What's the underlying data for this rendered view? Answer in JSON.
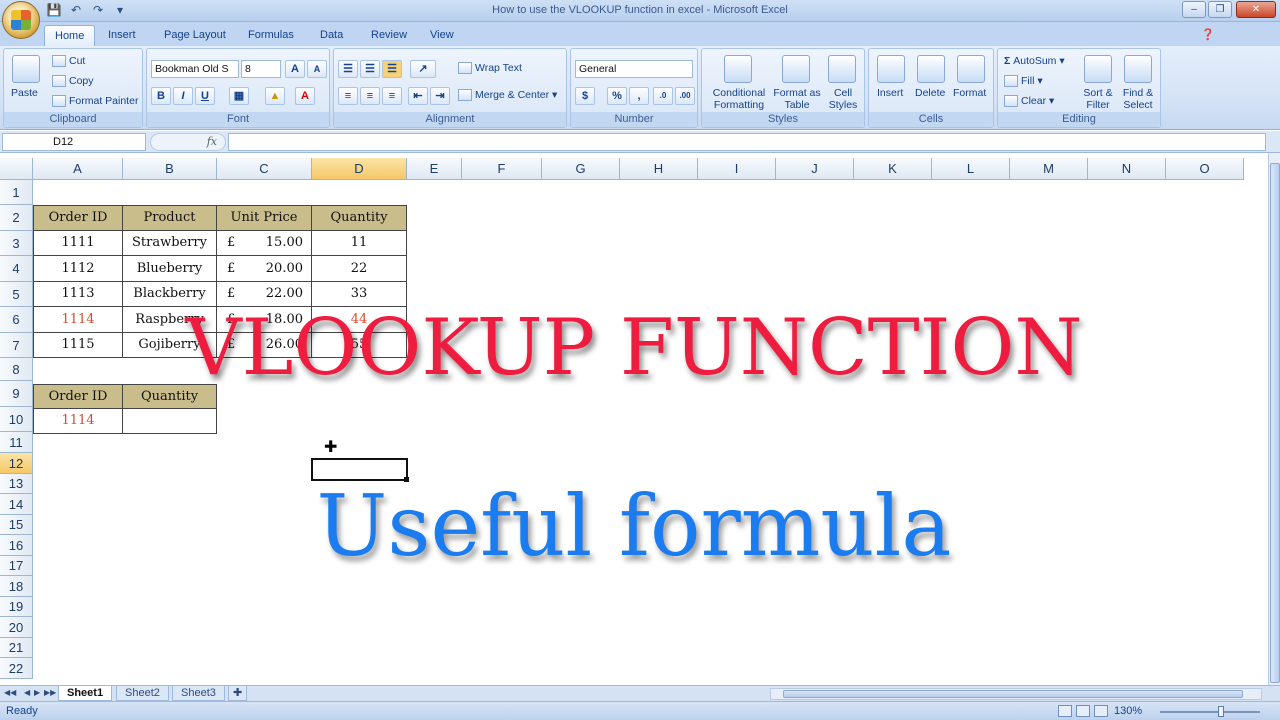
{
  "window": {
    "title": "How to use the VLOOKUP function in excel - Microsoft Excel"
  },
  "ribbon_tabs": [
    "Home",
    "Insert",
    "Page Layout",
    "Formulas",
    "Data",
    "Review",
    "View"
  ],
  "ribbon": {
    "clipboard": {
      "label": "Clipboard",
      "paste": "Paste",
      "cut": "Cut",
      "copy": "Copy",
      "format_painter": "Format Painter"
    },
    "font": {
      "label": "Font",
      "font_name": "Bookman Old S",
      "font_size": "8",
      "bold": "B",
      "italic": "I",
      "underline": "U"
    },
    "alignment": {
      "label": "Alignment",
      "wrap_text": "Wrap Text",
      "merge_center": "Merge & Center"
    },
    "number": {
      "label": "Number",
      "format": "General",
      "currency": "$",
      "percent": "%",
      "comma": ","
    },
    "styles": {
      "label": "Styles",
      "conditional_formatting": "Conditional Formatting",
      "format_as_table": "Format as Table",
      "cell_styles": "Cell Styles"
    },
    "cells": {
      "label": "Cells",
      "insert": "Insert",
      "delete": "Delete",
      "format": "Format"
    },
    "editing": {
      "label": "Editing",
      "autosum": "AutoSum",
      "fill": "Fill",
      "clear": "Clear",
      "sort_filter": "Sort & Filter",
      "find_select": "Find & Select"
    }
  },
  "formula_bar": {
    "name_box": "D12",
    "fx": "fx",
    "formula": ""
  },
  "columns": [
    "A",
    "B",
    "C",
    "D",
    "E",
    "F",
    "G",
    "H",
    "I",
    "J",
    "K",
    "L",
    "M",
    "N",
    "O"
  ],
  "rows": [
    "1",
    "2",
    "3",
    "4",
    "5",
    "6",
    "7",
    "8",
    "9",
    "10",
    "11",
    "12",
    "13",
    "14",
    "15",
    "16",
    "17",
    "18",
    "19",
    "20",
    "21",
    "22"
  ],
  "selected": {
    "column": "D",
    "row": "12"
  },
  "table": {
    "headers": [
      "Order ID",
      "Product",
      "Unit Price",
      "Quantity"
    ],
    "rows": [
      {
        "order_id": "1111",
        "product": "Strawberry",
        "currency": "£",
        "price": "15.00",
        "quantity": "11"
      },
      {
        "order_id": "1112",
        "product": "Blueberry",
        "currency": "£",
        "price": "20.00",
        "quantity": "22"
      },
      {
        "order_id": "1113",
        "product": "Blackberry",
        "currency": "£",
        "price": "22.00",
        "quantity": "33"
      },
      {
        "order_id": "1114",
        "product": "Raspberry",
        "currency": "£",
        "price": "18.00",
        "quantity": "44"
      },
      {
        "order_id": "1115",
        "product": "Gojiberry",
        "currency": "£",
        "price": "26.00",
        "quantity": "55"
      }
    ]
  },
  "lookup": {
    "headers": [
      "Order ID",
      "Quantity"
    ],
    "order_id": "1114",
    "quantity": ""
  },
  "overlay": {
    "title": "VLOOKUP FUNCTION",
    "subtitle": "Useful formula"
  },
  "sheets": [
    "Sheet1",
    "Sheet2",
    "Sheet3"
  ],
  "active_sheet": "Sheet1",
  "status": {
    "text": "Ready",
    "zoom": "130%"
  },
  "colors": {
    "highlight_red": "#d84a2e",
    "header_fill": "#cabd8c",
    "title_red": "#ee1d3f",
    "subtitle_blue": "#1b7cf0"
  }
}
